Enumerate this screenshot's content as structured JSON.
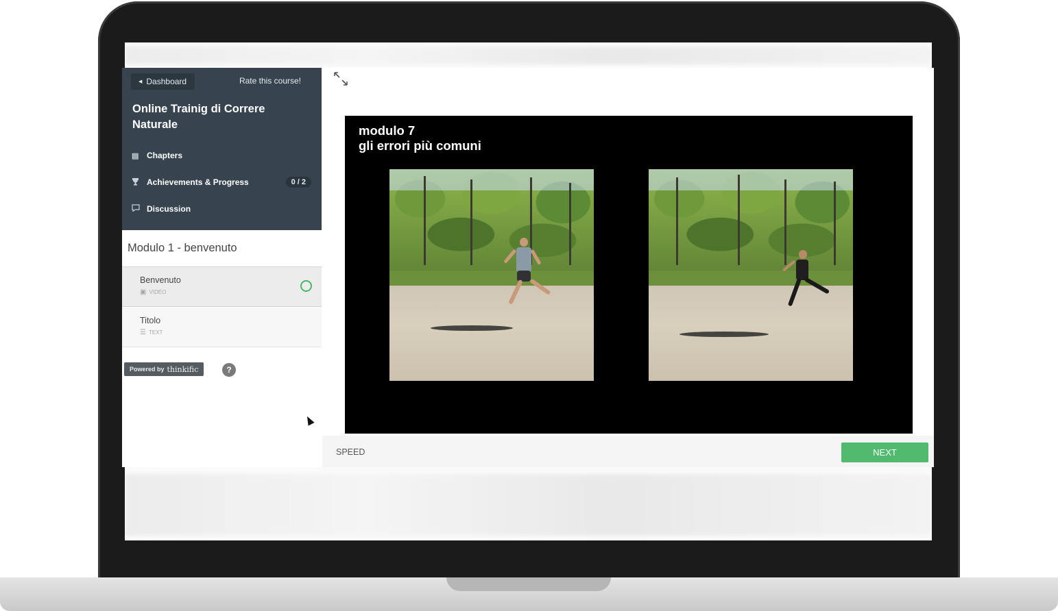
{
  "header": {
    "dashboard_label": "Dashboard",
    "rate_label": "Rate this course!"
  },
  "course": {
    "title": "Online Trainig di Correre Naturale"
  },
  "nav": [
    {
      "label": "Chapters",
      "icon": "book-icon"
    },
    {
      "label": "Achievements & Progress",
      "icon": "trophy-icon",
      "count": "0 / 2"
    },
    {
      "label": "Discussion",
      "icon": "chat-bubble-icon"
    }
  ],
  "chapter": {
    "title": "Modulo 1 - benvenuto",
    "lessons": [
      {
        "name": "Benvenuto",
        "type": "VIDEO",
        "icon": "video-icon",
        "active": true
      },
      {
        "name": "Titolo",
        "type": "TEXT",
        "icon": "text-icon",
        "active": false
      }
    ]
  },
  "footer": {
    "powered_prefix": "Powered by",
    "powered_brand": "thinkific",
    "help_label": "?"
  },
  "video": {
    "title_line1": "modulo 7",
    "title_line2": "gli errori più comuni"
  },
  "controls": {
    "speed_label": "SPEED",
    "next_label": "NEXT"
  },
  "colors": {
    "sidebar_bg": "#37444f",
    "accent_green": "#52ba6f",
    "video_bg": "#000000"
  }
}
